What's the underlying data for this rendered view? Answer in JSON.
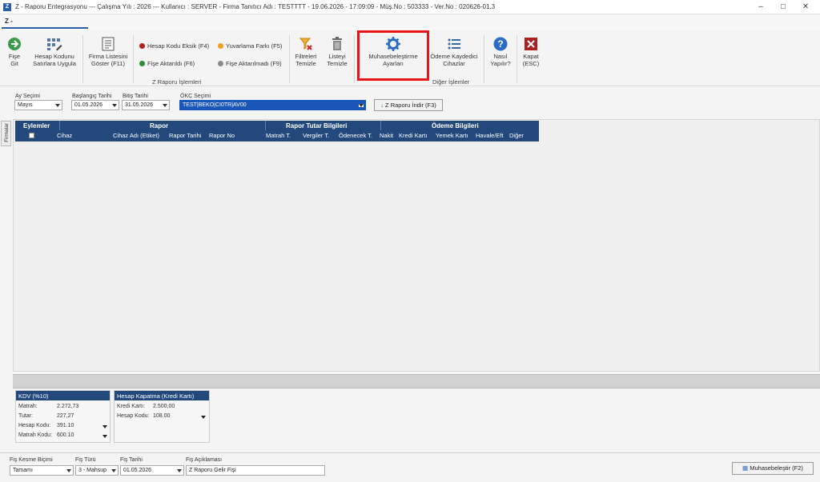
{
  "title_bar": {
    "text": "Z - Raporu Entegrasyonu  ---  Çalışma Yılı : 2026  ---  Kullanıcı : SERVER - Firma Tanıtıcı Adı : TESTTTT - 19.06.2026 - 17:09:09 - Müş.No : 503333 - Ver.No : 020626-01.3"
  },
  "tab": {
    "label": "Z -"
  },
  "ribbon": {
    "fise_git": {
      "line1": "Fişe",
      "line2": "Git"
    },
    "hesap_kodunu": {
      "line1": "Hesap Kodunu",
      "line2": "Satırlara Uygula"
    },
    "firma_listesini": {
      "line1": "Firma Listesini",
      "line2": "Göster (F11)"
    },
    "legend": {
      "hesap_kodu_eksik": "Hesap Kodu Eksik (F4)",
      "yuvarlama_farki": "Yuvarlama Farkı (F5)",
      "fise_aktarildi": "Fişe Aktarıldı (F6)",
      "fise_aktarilmadi": "Fişe Aktarılmadı (F9)"
    },
    "legend_colors": {
      "red": "#b22222",
      "orange": "#f0a020",
      "green": "#2e8b3e",
      "gray": "#8c8c8c"
    },
    "group1_label": "Z Raporu İşlemleri",
    "filtreleri": {
      "line1": "Filtreleri",
      "line2": "Temizle"
    },
    "listeyi": {
      "line1": "Listeyi",
      "line2": "Temizle"
    },
    "muhasebe": {
      "line1": "Muhasebeleştirme",
      "line2": "Ayarları"
    },
    "odeme": {
      "line1": "Ödeme Kaydedici",
      "line2": "Cihazlar"
    },
    "group2_label": "Diğer İşlemler",
    "nasil": {
      "line1": "Nasıl",
      "line2": "Yapılır?"
    },
    "kapat": {
      "line1": "Kapat",
      "line2": "(ESC)"
    },
    "highlight_color": "#e8141a"
  },
  "filters": {
    "ay_secimi": {
      "label": "Ay Seçimi",
      "value": "Mayıs"
    },
    "baslangic": {
      "label": "Başlangıç Tarihi",
      "value": "01.05.2026"
    },
    "bitis": {
      "label": "Bitiş Tarihi",
      "value": "31.05.2026"
    },
    "okc": {
      "label": "ÖKC Seçimi",
      "value": "TEST|BEKO|CI0TR|AV00"
    },
    "download_button": "Z Raporu İndir (F3)"
  },
  "side_tab": "Firmalar",
  "grid": {
    "groups": [
      "Eylemler",
      "Rapor",
      "Rapor Tutar Bilgileri",
      "Ödeme Bilgileri"
    ],
    "columns": [
      "Cihaz",
      "Cihaz Adı (Etiket)",
      "Rapor Tarihi",
      "Rapor No",
      "Matrah T.",
      "Vergiler T.",
      "Ödenecek T.",
      "Nakit",
      "Kredi Kartı",
      "Yemek Kartı",
      "Havale/Eft",
      "Diğer"
    ]
  },
  "kdv_panel": {
    "header": "KDV (%10)",
    "matrah_label": "Matrah:",
    "matrah_value": "2.272,73",
    "tutar_label": "Tutar:",
    "tutar_value": "227,27",
    "hesap_kodu_label": "Hesap Kodu:",
    "hesap_kodu_value": "391.10",
    "matrah_kodu_label": "Matrah Kodu:",
    "matrah_kodu_value": "600.10"
  },
  "hesap_panel": {
    "header": "Hesap Kapatma (Kredi Kartı)",
    "kredi_label": "Kredi Kartı:",
    "kredi_value": "2.500,00",
    "hesap_kodu_label": "Hesap Kodu:",
    "hesap_kodu_value": "108.00"
  },
  "bottom": {
    "fis_kesme": {
      "label": "Fiş Kesme Biçimi",
      "value": "Tamamı"
    },
    "fis_turu": {
      "label": "Fiş Türü",
      "value": "3 - Mahsup"
    },
    "fis_tarihi": {
      "label": "Fiş Tarihi",
      "value": "01.05.2026"
    },
    "fis_aciklamasi": {
      "label": "Fiş Açıklaması",
      "value": "Z Raporu Gelir Fişi"
    },
    "muhasebelestir_button": "Muhasebeleştir (F2)"
  }
}
